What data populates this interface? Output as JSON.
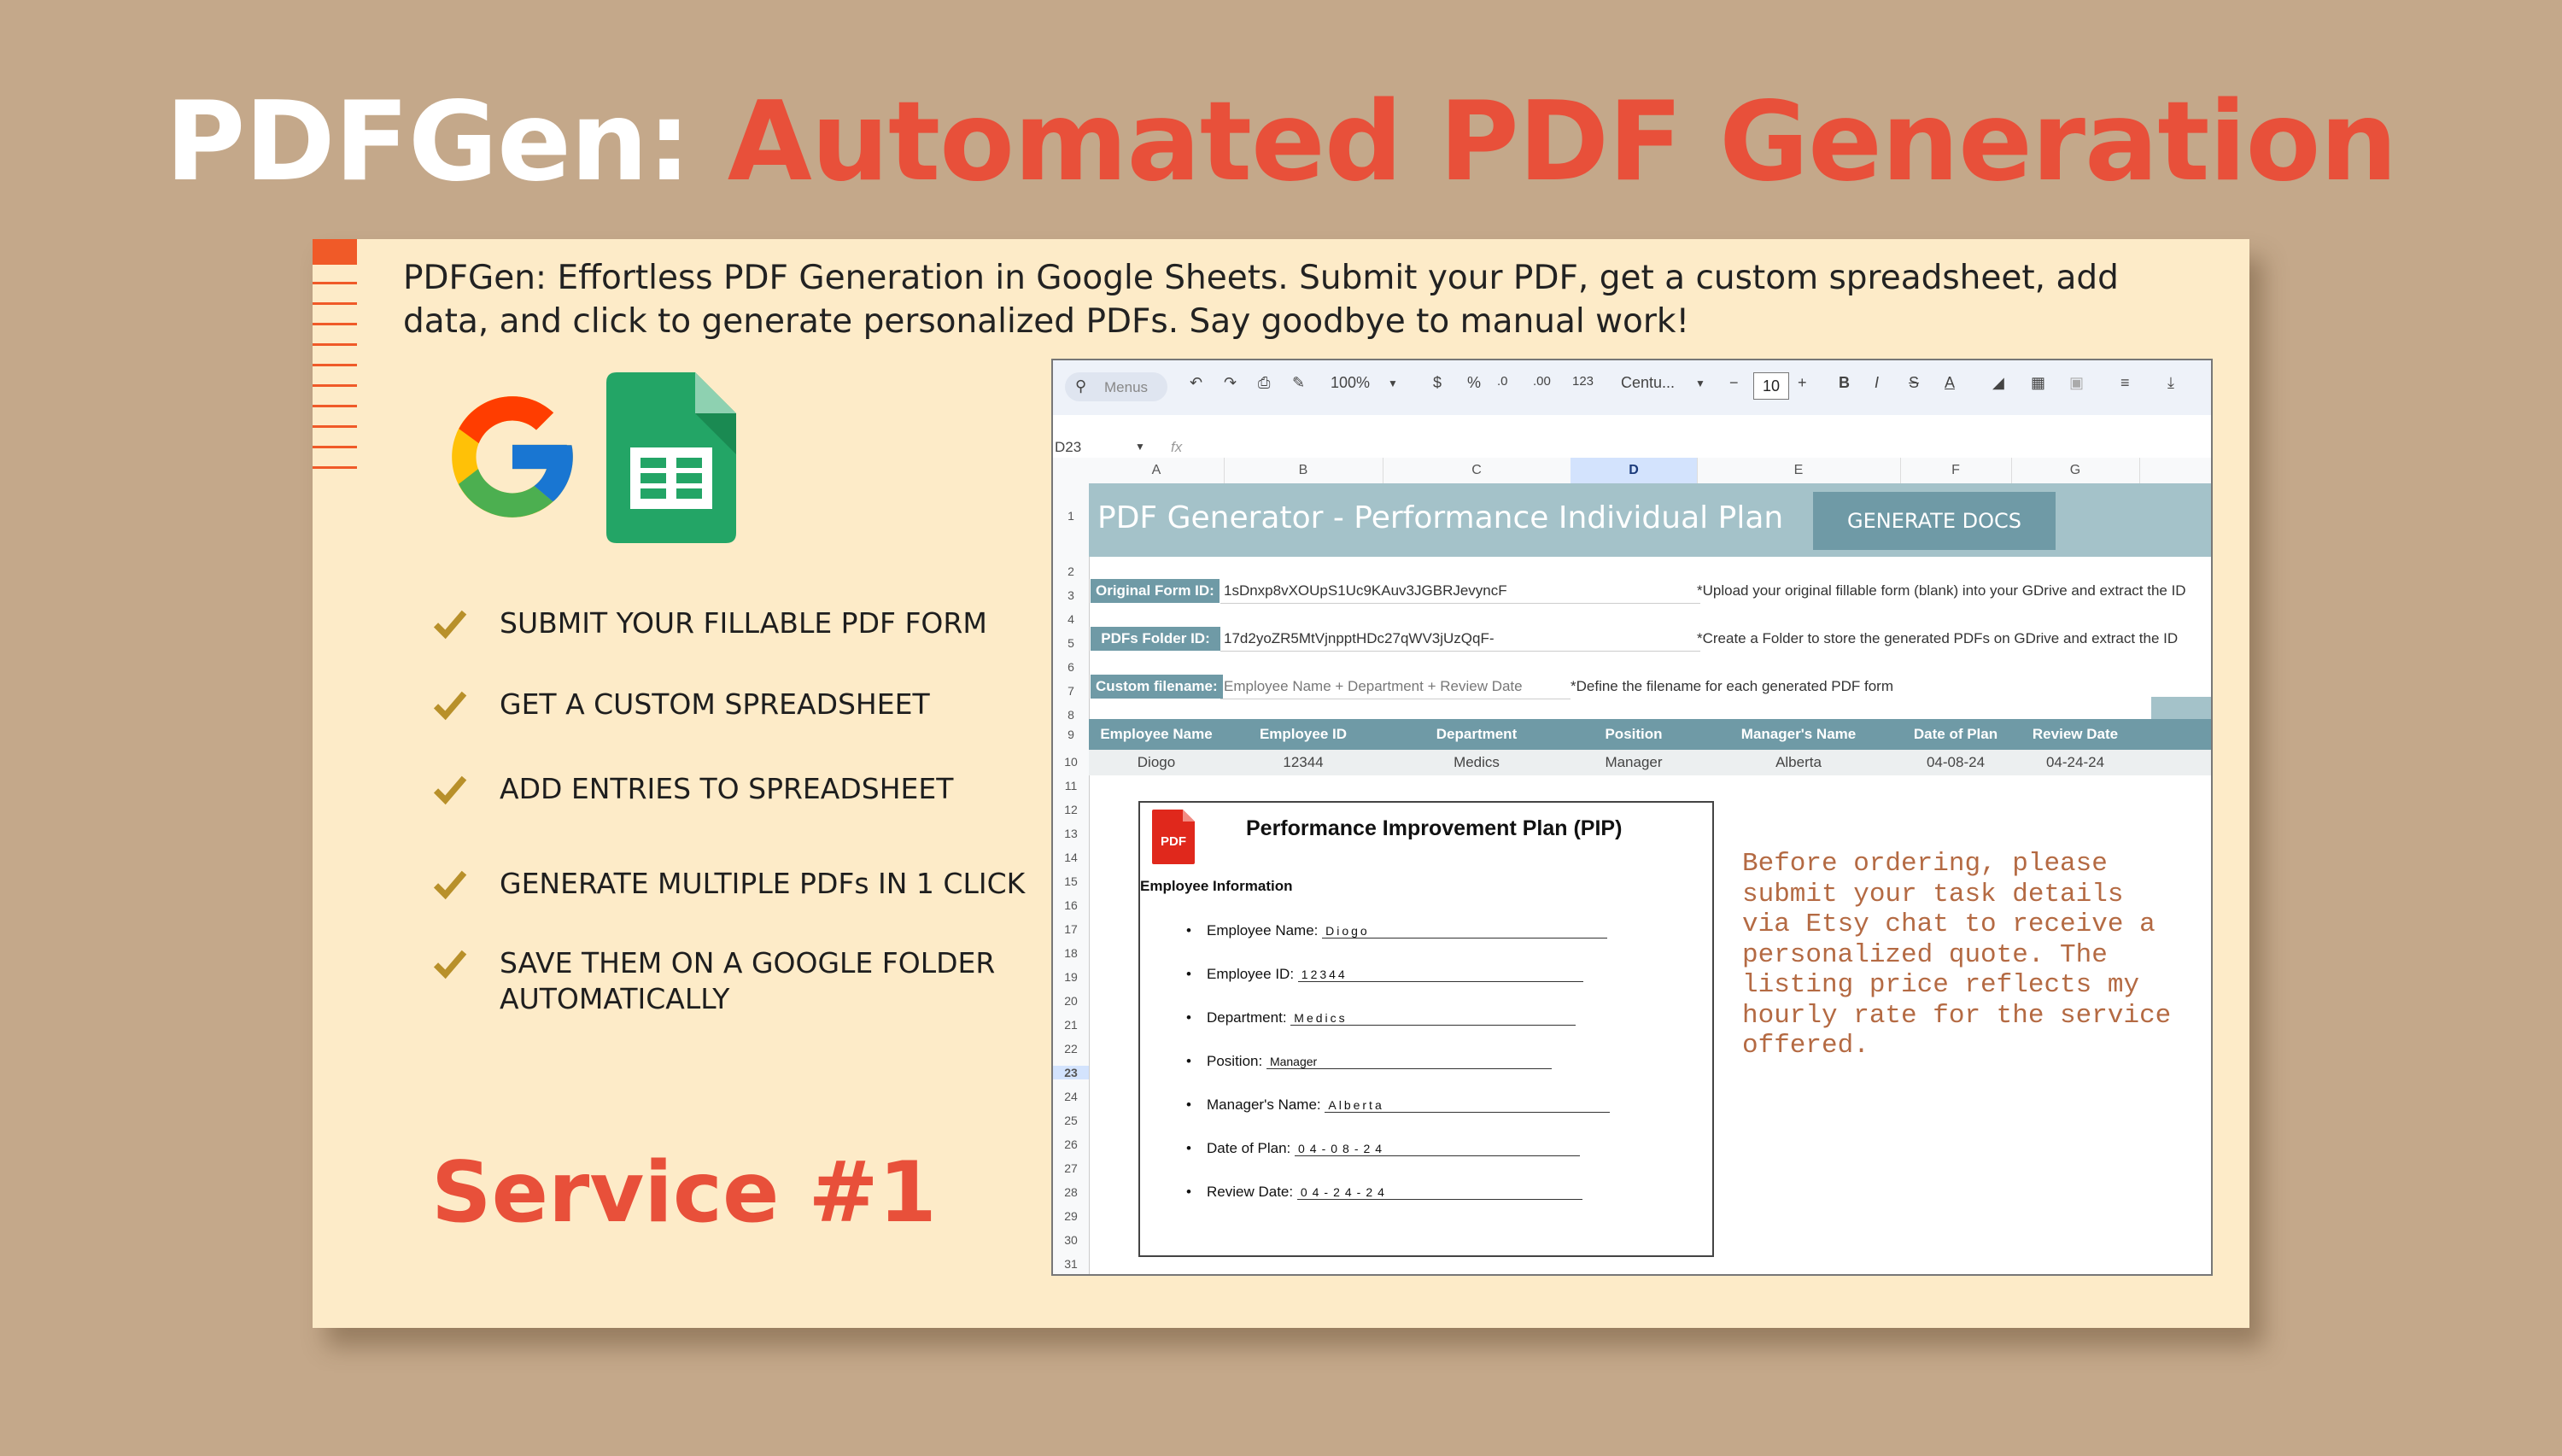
{
  "headline": {
    "part1": "PDFGen: ",
    "part2": "Automated PDF Generation"
  },
  "colors": {
    "accent": "#e8503a",
    "background": "#c4a88a",
    "card": "#fdebc8",
    "sheet_teal": "#6f9aa6"
  },
  "intro": "PDFGen: Effortless PDF Generation in Google Sheets. Submit your PDF, get a custom spreadsheet, add data, and click to generate personalized PDFs. Say goodbye to manual work!",
  "logos": {
    "google": "google-logo",
    "sheets": "google-sheets-logo"
  },
  "features": [
    "SUBMIT YOUR FILLABLE PDF FORM",
    "GET A CUSTOM SPREADSHEET",
    "ADD ENTRIES TO SPREADSHEET",
    "GENERATE MULTIPLE PDFs IN 1 CLICK",
    "SAVE THEM ON A GOOGLE FOLDER",
    "AUTOMATICALLY"
  ],
  "service": "Service #1",
  "sheet": {
    "toolbar": {
      "search": "Menus",
      "zoom": "100%",
      "currency": "$",
      "percent": "%",
      "dec_less": ".0",
      "dec_more": ".00",
      "number_format": "123",
      "font": "Centu...",
      "font_size": "10",
      "bold": "B",
      "italic": "I",
      "strike": "S",
      "text_color": "A"
    },
    "cell_ref": "D23",
    "fx": "fx",
    "columns": [
      "A",
      "B",
      "C",
      "D",
      "E",
      "F",
      "G"
    ],
    "rows": [
      "1",
      "2",
      "3",
      "4",
      "5",
      "6",
      "7",
      "8",
      "9",
      "10",
      "11",
      "12",
      "13",
      "14",
      "15",
      "16",
      "17",
      "18",
      "19",
      "20",
      "21",
      "22",
      "23",
      "24",
      "25",
      "26",
      "27",
      "28",
      "29",
      "30",
      "31"
    ],
    "title": "PDF Generator - Performance Individual Plan",
    "generate_button": "GENERATE DOCS",
    "form_id_label": "Original Form ID:",
    "form_id_value": "1sDnxp8vXOUpS1Uc9KAuv3JGBRJevyncF",
    "form_id_note": "*Upload your original fillable form (blank) into your GDrive and extract the ID",
    "folder_label": "PDFs Folder ID:",
    "folder_value": "17d2yoZR5MtVjnpptHDc27qWV3jUzQqF-",
    "folder_note": "*Create a Folder to store the generated PDFs on GDrive and extract the ID",
    "filename_label": "Custom filename:",
    "filename_value": "Employee Name + Department + Review Date",
    "filename_note": "*Define the filename for each generated PDF form",
    "headers": [
      "Employee Name",
      "Employee ID",
      "Department",
      "Position",
      "Manager's Name",
      "Date of Plan",
      "Review Date"
    ],
    "row": [
      "Diogo",
      "12344",
      "Medics",
      "Manager",
      "Alberta",
      "04-08-24",
      "04-24-24"
    ]
  },
  "pdf": {
    "icon_label": "PDF",
    "title": "Performance Improvement Plan (PIP)",
    "section": "Employee Information",
    "fields": [
      {
        "label": "Employee Name:",
        "value": "Diogo"
      },
      {
        "label": "Employee ID:",
        "value": "12344"
      },
      {
        "label": "Department:",
        "value": "Medics"
      },
      {
        "label": "Position:",
        "value": "Manager"
      },
      {
        "label": "Manager's Name:",
        "value": "Alberta"
      },
      {
        "label": "Date of Plan:",
        "value": "04-08-24"
      },
      {
        "label": "Review Date:",
        "value": "04-24-24"
      }
    ]
  },
  "note": "Before ordering, please submit your task details via Etsy chat to receive a personalized quote. The listing price reflects my hourly rate for the service offered."
}
